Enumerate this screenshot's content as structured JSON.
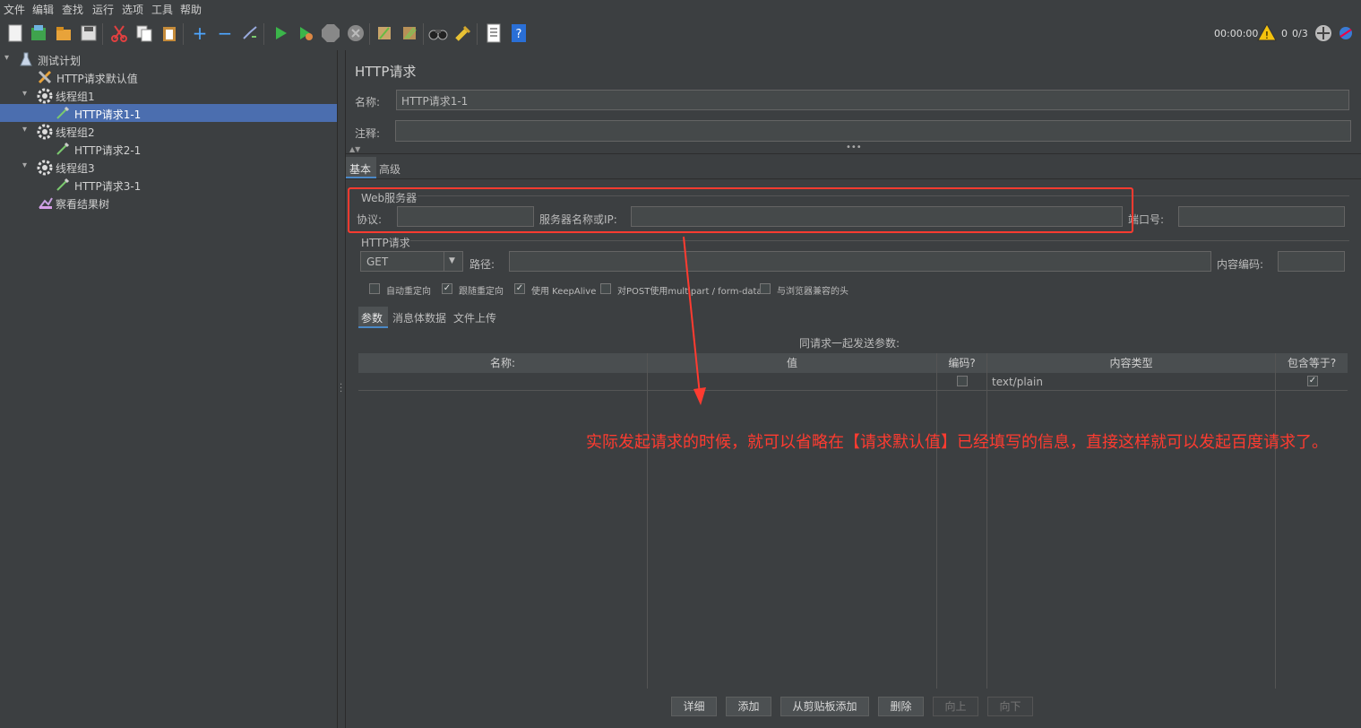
{
  "menu": [
    "文件",
    "编辑",
    "查找",
    "运行",
    "选项",
    "工具",
    "帮助"
  ],
  "toolbar": {
    "timer": "00:00:00",
    "warn_count": "0",
    "thread_ratio": "0/3"
  },
  "tree": [
    {
      "label": "测试计划",
      "icon": "flask-icon",
      "depth": 0
    },
    {
      "label": "HTTP请求默认值",
      "icon": "tools-icon",
      "depth": 1
    },
    {
      "label": "线程组1",
      "icon": "gear-icon",
      "depth": 1
    },
    {
      "label": "HTTP请求1-1",
      "icon": "pipette-icon",
      "depth": 2,
      "selected": true
    },
    {
      "label": "线程组2",
      "icon": "gear-icon",
      "depth": 1
    },
    {
      "label": "HTTP请求2-1",
      "icon": "pipette-icon",
      "depth": 2
    },
    {
      "label": "线程组3",
      "icon": "gear-icon",
      "depth": 1
    },
    {
      "label": "HTTP请求3-1",
      "icon": "pipette-icon",
      "depth": 2
    },
    {
      "label": "察看结果树",
      "icon": "chart-icon",
      "depth": 1
    }
  ],
  "panel": {
    "title": "HTTP请求",
    "name_label": "名称:",
    "name_value": "HTTP请求1-1",
    "comment_label": "注释:",
    "tabs": [
      "基本",
      "高级"
    ],
    "web_server_group": "Web服务器",
    "protocol_label": "协议:",
    "server_label": "服务器名称或IP:",
    "port_label": "端口号:",
    "http_group": "HTTP请求",
    "method": "GET",
    "path_label": "路径:",
    "encoding_label": "内容编码:",
    "checkboxes": [
      {
        "label": "自动重定向",
        "checked": false
      },
      {
        "label": "跟随重定向",
        "checked": true
      },
      {
        "label": "使用 KeepAlive",
        "checked": true
      },
      {
        "label": "对POST使用multipart / form-data",
        "checked": false
      },
      {
        "label": "与浏览器兼容的头",
        "checked": false
      }
    ],
    "subtabs": [
      "参数",
      "消息体数据",
      "文件上传"
    ],
    "params_caption": "同请求一起发送参数:",
    "columns": [
      "名称:",
      "值",
      "编码?",
      "内容类型",
      "包含等于?"
    ],
    "row": {
      "content_type": "text/plain",
      "encode": false,
      "include_equals": true
    },
    "buttons": [
      {
        "label": "详细",
        "enabled": true
      },
      {
        "label": "添加",
        "enabled": true
      },
      {
        "label": "从剪贴板添加",
        "enabled": true
      },
      {
        "label": "删除",
        "enabled": true
      },
      {
        "label": "向上",
        "enabled": false
      },
      {
        "label": "向下",
        "enabled": false
      }
    ]
  },
  "annotation": {
    "text": "实际发起请求的时候，就可以省略在【请求默认值】已经填写的信息，直接这样就可以发起百度请求了。",
    "color": "#ff3b30"
  }
}
